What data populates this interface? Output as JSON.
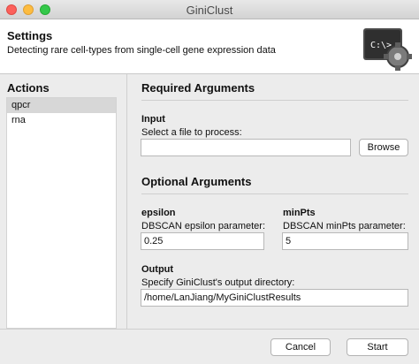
{
  "window": {
    "title": "GiniClust"
  },
  "header": {
    "title": "Settings",
    "subtitle": "Detecting rare cell-types from single-cell gene expression data",
    "icon_text": "C:\\>_",
    "icon": "terminal-gear-icon"
  },
  "actions": {
    "title": "Actions",
    "items": [
      {
        "label": "qpcr",
        "selected": true
      },
      {
        "label": "rna",
        "selected": false
      }
    ]
  },
  "required": {
    "title": "Required Arguments",
    "input_label": "Input",
    "input_help": "Select a file to process:",
    "input_value": "",
    "browse_label": "Browse"
  },
  "optional": {
    "title": "Optional Arguments",
    "epsilon_label": "epsilon",
    "epsilon_help": "DBSCAN epsilon parameter:",
    "epsilon_value": "0.25",
    "minpts_label": "minPts",
    "minpts_help": "DBSCAN minPts parameter:",
    "minpts_value": "5",
    "output_label": "Output",
    "output_help": "Specify GiniClust's output directory:",
    "output_value": "/home/LanJiang/MyGiniClustResults"
  },
  "footer": {
    "cancel_label": "Cancel",
    "start_label": "Start"
  }
}
